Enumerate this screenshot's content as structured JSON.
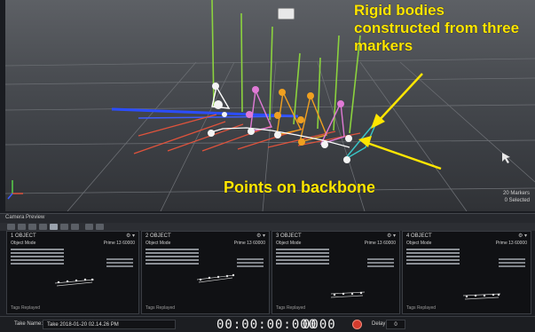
{
  "annotations": {
    "rigid_bodies": "Rigid bodies constructed from three markers",
    "points_on_backbone": "Points on backbone"
  },
  "viewport": {
    "marker_count": "20 Markers",
    "selected": "0 Selected"
  },
  "camera_preview": {
    "header": "Camera Preview",
    "cameras": [
      {
        "title": "1  OBJECT",
        "mode": "Object Mode",
        "fps": "Prime 13 60000"
      },
      {
        "title": "2  OBJECT",
        "mode": "Object Mode",
        "fps": "Prime 13 60000"
      },
      {
        "title": "3  OBJECT",
        "mode": "Object Mode",
        "fps": "Prime 13 60000"
      },
      {
        "title": "4  OBJECT",
        "mode": "Object Mode",
        "fps": "Prime 13 60000"
      }
    ],
    "menu_glyph": "⚙ ▾",
    "footer": "Tags  Replayed"
  },
  "take_bar": {
    "label": "Take Name:",
    "name": "Take 2018-01-20 02.14.26 PM",
    "timecode": "00:00:00:000",
    "frames": "0000",
    "delay_label": "Delay",
    "delay_value": "0"
  },
  "colors": {
    "annotation": "#ffe600",
    "green_marker_line": "#8bd23e",
    "red_grid_line": "#e0533c",
    "blue_axis": "#2b4dff",
    "rigid_body_pink": "#e07ad6",
    "rigid_body_orange": "#f0a020",
    "rigid_body_cyan": "#39c6c8",
    "record": "#d43b2e"
  },
  "icons": {
    "record": "record-icon",
    "camera_menu": "gear-icon",
    "axis_gizmo": "axis-gizmo-icon",
    "arrow": "arrow-annotation"
  }
}
